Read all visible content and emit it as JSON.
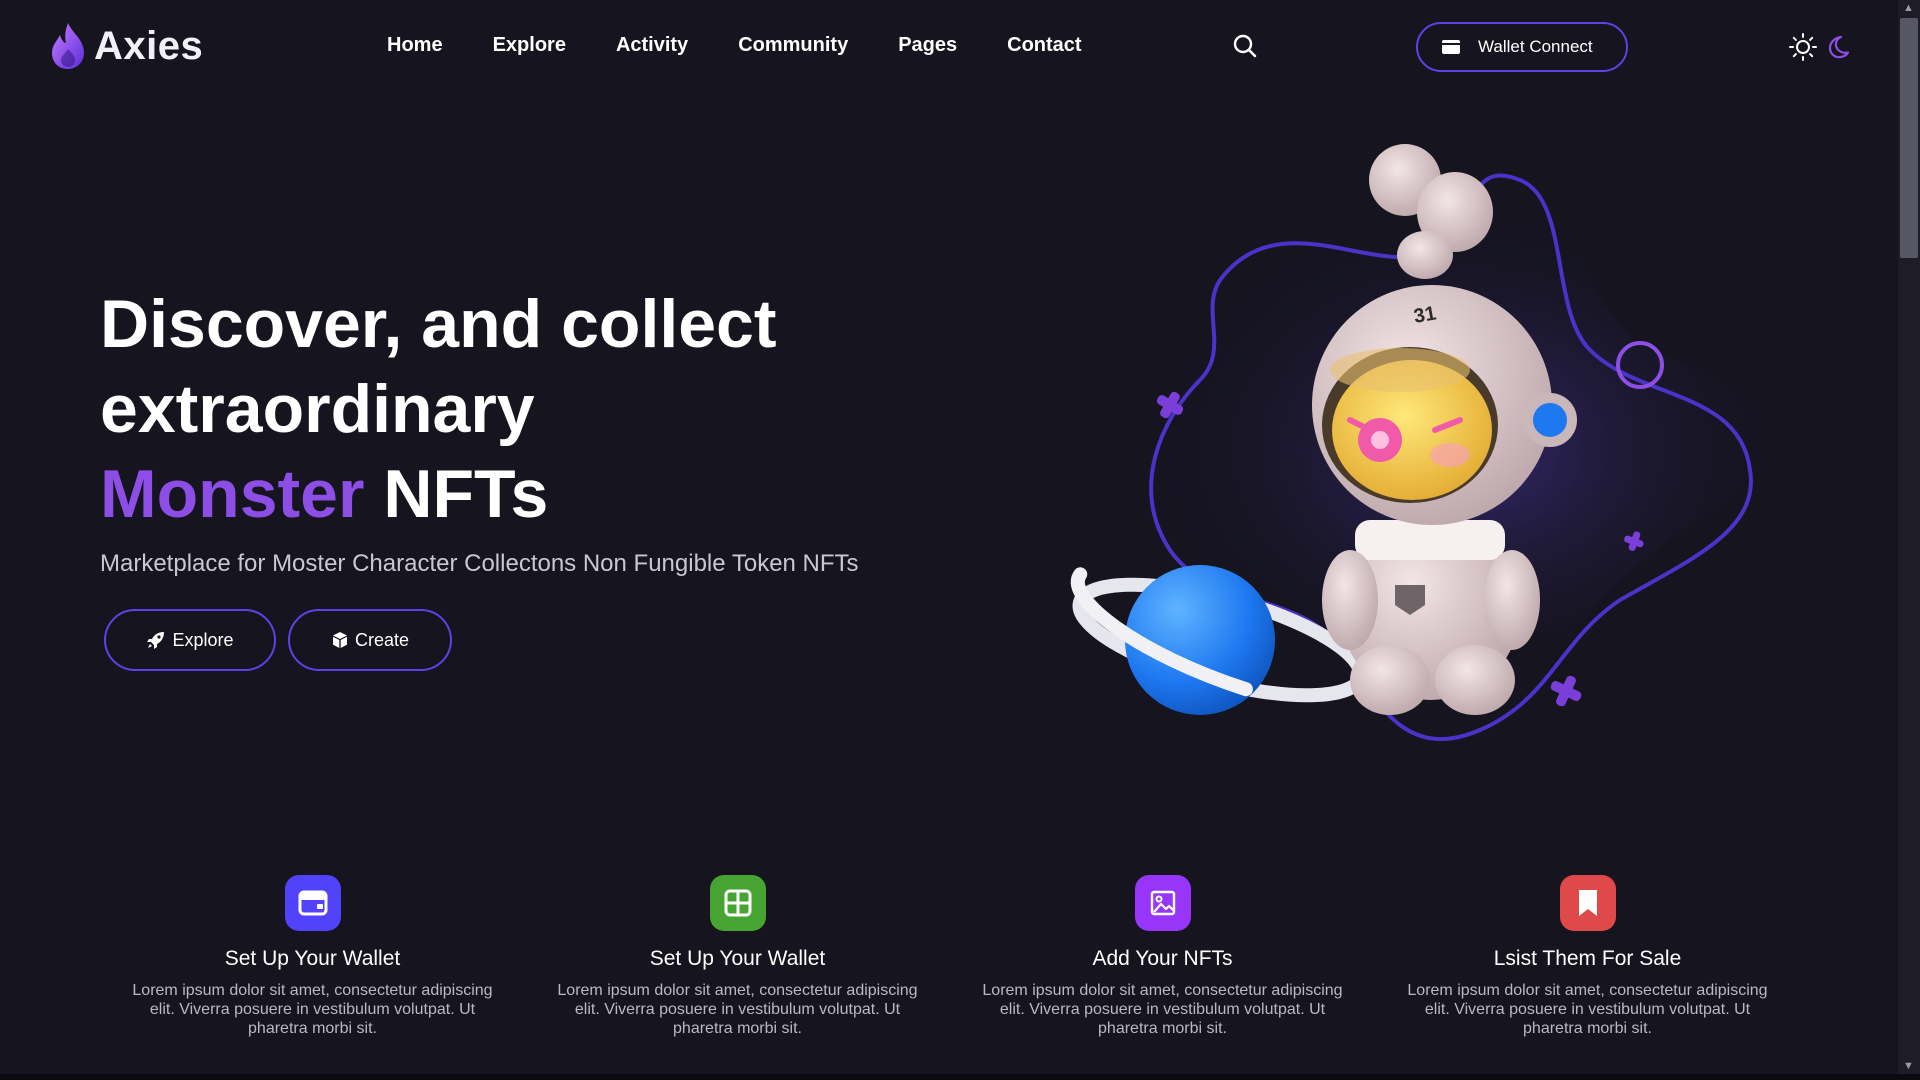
{
  "brand": {
    "name": "Axies"
  },
  "nav": [
    {
      "label": "Home"
    },
    {
      "label": "Explore"
    },
    {
      "label": "Activity"
    },
    {
      "label": "Community"
    },
    {
      "label": "Pages"
    },
    {
      "label": "Contact"
    }
  ],
  "header": {
    "wallet_label": "Wallet Connect"
  },
  "hero": {
    "title_line1": "Discover, and collect",
    "title_line2": "extraordinary",
    "title_accent": "Monster",
    "title_end": "NFTs",
    "subtitle": "Marketplace for Moster Character Collectons Non Fungible Token NFTs",
    "explore_label": "Explore",
    "create_label": "Create"
  },
  "steps": [
    {
      "title": "Set Up Your Wallet",
      "desc": "Lorem ipsum dolor sit amet, consectetur adipiscing elit. Viverra posuere in vestibulum volutpat. Ut pharetra morbi sit.",
      "icon": "wallet-icon",
      "color": "#5142fc"
    },
    {
      "title": "Set Up Your Wallet",
      "desc": "Lorem ipsum dolor sit amet, consectetur adipiscing elit. Viverra posuere in vestibulum volutpat. Ut pharetra morbi sit.",
      "icon": "grid-icon",
      "color": "#47a432"
    },
    {
      "title": "Add Your NFTs",
      "desc": "Lorem ipsum dolor sit amet, consectetur adipiscing elit. Viverra posuere in vestibulum volutpat. Ut pharetra morbi sit.",
      "icon": "image-icon",
      "color": "#9835fb"
    },
    {
      "title": "Lsist Them For Sale",
      "desc": "Lorem ipsum dolor sit amet, consectetur adipiscing elit. Viverra posuere in vestibulum volutpat. Ut pharetra morbi sit.",
      "icon": "bookmark-icon",
      "color": "#df4949"
    }
  ],
  "colors": {
    "background": "#15141f",
    "accent_purple": "#8d4ee6",
    "button_border": "#5a44e6"
  }
}
